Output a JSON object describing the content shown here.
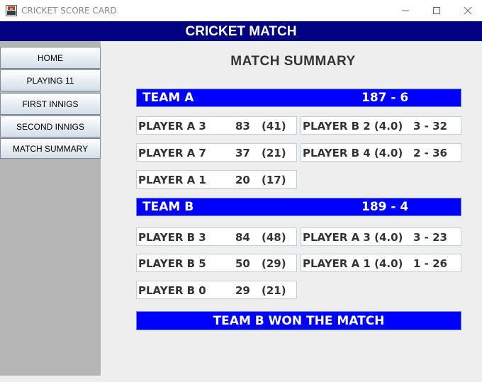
{
  "window": {
    "title": "CRICKET SCORE CARD",
    "controls": {
      "minimize": "—",
      "maximize": "☐",
      "close": "✕"
    },
    "icon": "cricket-app-icon"
  },
  "header": {
    "title": "CRICKET MATCH"
  },
  "sidebar": {
    "items": [
      {
        "label": "HOME"
      },
      {
        "label": "PLAYING 11"
      },
      {
        "label": "FIRST INNIGS"
      },
      {
        "label": "SECOND INNIGS"
      },
      {
        "label": "MATCH SUMMARY"
      }
    ]
  },
  "summary": {
    "title": "MATCH  SUMMARY",
    "team_a": {
      "name": "TEAM A",
      "score": "187 - 6",
      "batsmen": [
        {
          "name": "PLAYER A 3",
          "runs": "83",
          "balls": "(41)"
        },
        {
          "name": "PLAYER A 7",
          "runs": "37",
          "balls": "(21)"
        },
        {
          "name": "PLAYER A 1",
          "runs": "20",
          "balls": "(17)"
        }
      ],
      "bowlers": [
        {
          "name": "PLAYER B 2 (4.0)",
          "figures": "3 - 32"
        },
        {
          "name": "PLAYER B 4 (4.0)",
          "figures": "2 - 36"
        }
      ]
    },
    "team_b": {
      "name": "TEAM B",
      "score": "189 - 4",
      "batsmen": [
        {
          "name": "PLAYER B 3",
          "runs": "84",
          "balls": "(48)"
        },
        {
          "name": "PLAYER B 5",
          "runs": "50",
          "balls": "(29)"
        },
        {
          "name": "PLAYER B 0",
          "runs": "29",
          "balls": "(21)"
        }
      ],
      "bowlers": [
        {
          "name": "PLAYER A 3 (4.0)",
          "figures": "3 - 23"
        },
        {
          "name": "PLAYER A 1 (4.0)",
          "figures": "1 - 26"
        }
      ]
    },
    "result": "TEAM B WON THE MATCH"
  },
  "colors": {
    "header_bg": "#000080",
    "team_bar_bg": "#0000ff",
    "sidebar_bg": "#b5b5b5",
    "text_dark": "#333333"
  }
}
